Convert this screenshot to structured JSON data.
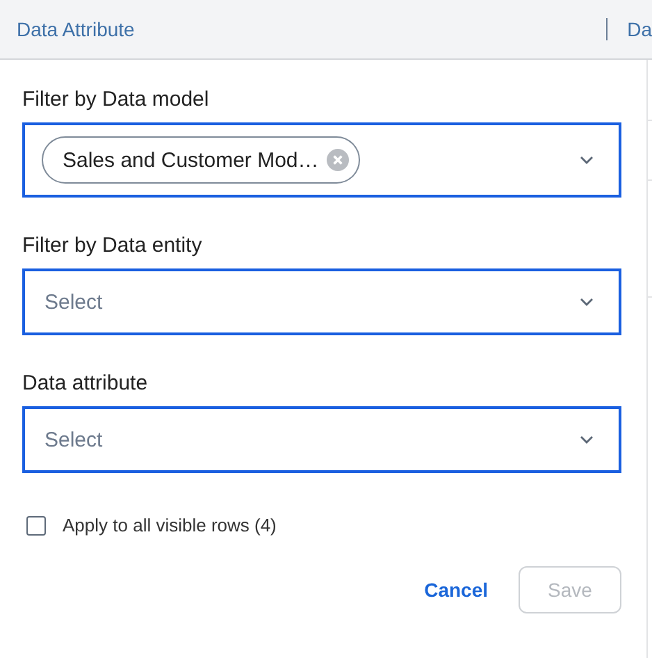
{
  "header": {
    "columns": [
      {
        "label": "Data Attribute"
      },
      {
        "label": "Da"
      }
    ]
  },
  "filters": [
    {
      "label": "Filter by Data model",
      "chips": [
        "Sales and Customer Mod…"
      ]
    },
    {
      "label": "Filter by Data entity",
      "placeholder": "Select"
    },
    {
      "label": "Data attribute",
      "placeholder": "Select"
    }
  ],
  "apply_all": {
    "label": "Apply to all visible rows (4)",
    "checked": false
  },
  "buttons": [
    {
      "label": "Cancel",
      "kind": "link",
      "disabled": false
    },
    {
      "label": "Save",
      "kind": "outline",
      "disabled": true
    }
  ]
}
